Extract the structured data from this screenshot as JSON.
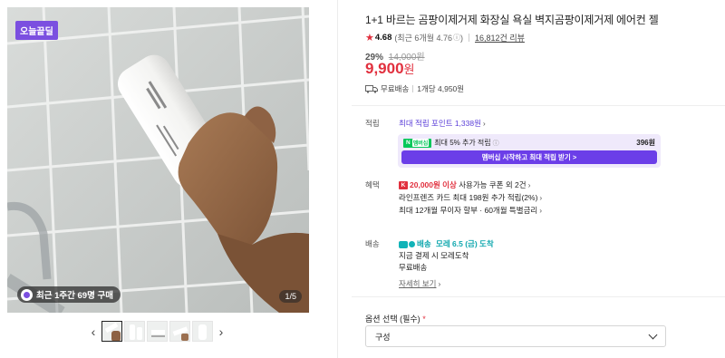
{
  "gallery": {
    "badge": "오늘끝딜",
    "buyers_text": "최근 1주간 69명 구매",
    "pager": "1/5",
    "thumb_count": 5,
    "active_thumb": 0,
    "prev_icon": "chevron-left-icon",
    "next_icon": "chevron-right-icon"
  },
  "product": {
    "title": "1+1 바르는 곰팡이제거제 화장실 욕실 벽지곰팡이제거제 에어컨 젤",
    "rating": "4.68",
    "rating_recent": "(최근 6개월 4.76",
    "reviews": "16,812건 리뷰",
    "discount_rate": "29%",
    "original_price": "14,000원",
    "price": "9,900",
    "price_unit": "원",
    "shipping": "무료배송",
    "unit_price": "1개당 4,950원"
  },
  "points": {
    "label": "적립",
    "max_points": "최대 적립 포인트 1,338원",
    "np_logo_n": "N",
    "np_logo_sub": "멤버십",
    "np_text": "최대 5% 추가 적립",
    "np_amount": "396원",
    "np_button": "멤버십 시작하고 최대 적립 받기 >"
  },
  "benefits": {
    "label": "혜택",
    "coupon_tag": "K",
    "coupon_highlight": "20,000원 이상",
    "coupon_text": " 사용가능 쿠폰 외 2건",
    "card_text": "라인프렌즈 카드 최대 198원 추가 적립(2%)",
    "installment_text": "최대 12개월 무이자 할부 · 60개월 특별금리"
  },
  "delivery": {
    "label": "배송",
    "badge_text": "배송",
    "arrival": "모레 6.5 (금) 도착",
    "pay_note": "지금 결제 시 모레도착",
    "fee": "무료배송",
    "detail_link": "자세히 보기"
  },
  "options": {
    "label": "옵션 선택 (필수)",
    "required_mark": "*",
    "selected": "구성"
  },
  "colors": {
    "accent_red": "#e1303e",
    "purple": "#6b3ee8",
    "teal": "#0fa7ae"
  }
}
